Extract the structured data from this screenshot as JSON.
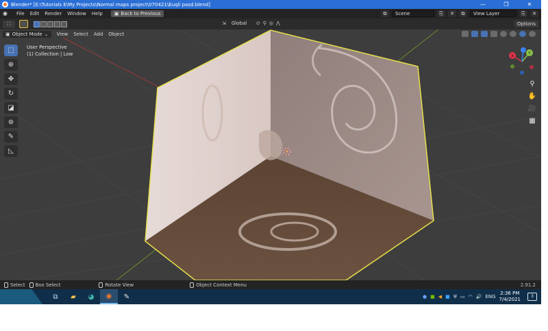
{
  "titlebar": {
    "title": "Blender* [E:\\Tutorials E\\My Projects\\Normal maps project\\070421\\Euqli pasd.blend]",
    "minimize": "—",
    "maximize": "❐",
    "close": "✕"
  },
  "menubar": {
    "items": [
      "File",
      "Edit",
      "Render",
      "Window",
      "Help"
    ],
    "back_button": "Back to Previous",
    "scene_label": "Scene",
    "view_layer_label": "View Layer"
  },
  "toolheader": {
    "orientation": "Global",
    "options_label": "Options"
  },
  "viewport_header": {
    "mode": "Object Mode",
    "menus": [
      "View",
      "Select",
      "Add",
      "Object"
    ]
  },
  "viewport": {
    "perspective_label": "User Perspective",
    "collection_label": "(1) Collection | Low"
  },
  "gizmo": {
    "x_label": "X",
    "y_label": "Y",
    "z_label": "Z",
    "x_color": "#e0334a",
    "y_color": "#8bc34a",
    "z_color": "#3b82f0"
  },
  "statusbar": {
    "select": "Select",
    "box_select": "Box Select",
    "rotate_view": "Rotate View",
    "context_menu": "Object Context Menu",
    "version": "2.91.2"
  },
  "taskbar": {
    "language": "ENG",
    "time": "2:36 PM",
    "date": "7/4/2021",
    "notifications": "3"
  },
  "colors": {
    "accent": "#4772b3",
    "selection_outline": "#e6e04a",
    "viewport_bg": "#3d3d3d",
    "titlebar": "#2b6fd6",
    "taskbar": "#0f2e49"
  },
  "icons": {
    "toolbar": [
      "select-box-icon",
      "cursor-icon",
      "move-icon",
      "rotate-icon",
      "scale-icon",
      "transform-icon",
      "annotate-icon",
      "measure-icon"
    ],
    "nav": [
      "zoom-icon",
      "pan-icon",
      "camera-icon",
      "grid-icon"
    ]
  }
}
